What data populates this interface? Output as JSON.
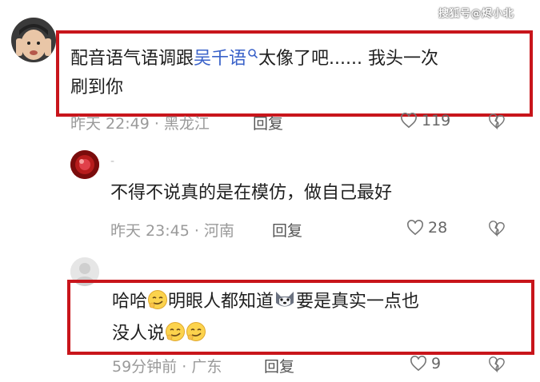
{
  "watermark": "搜狐号@烬小北",
  "comments": [
    {
      "username": "",
      "text_before": "配音语气语调跟",
      "link_text": "吴千语",
      "text_after": "太像了吧...... 我头一次",
      "text_line2": "刷到你",
      "time": "昨天 22:49",
      "location": "黑龙江",
      "reply_label": "回复",
      "likes": "119",
      "highlighted": true
    },
    {
      "username": "-",
      "text": "不得不说真的是在模仿，做自己最好",
      "time": "昨天 23:45",
      "location": "河南",
      "reply_label": "回复",
      "likes": "28",
      "highlighted": false
    },
    {
      "username": "",
      "text_part1": "哈哈",
      "text_part2": "明眼人都知道",
      "text_part3": "要是真实一点也",
      "text_line2": "没人说",
      "time": "59分钟前",
      "location": "广东",
      "reply_label": "回复",
      "likes": "9",
      "highlighted": true
    }
  ],
  "colors": {
    "highlight_border": "#c8151b",
    "link": "#3a62c9",
    "meta": "#9a9a9a"
  },
  "icons": {
    "like": "heart-outline-icon",
    "dislike": "broken-heart-icon",
    "emoji_smirk": "smirk-emoji-icon",
    "emoji_dog": "husky-dog-emoji-icon",
    "search": "magnifier-icon"
  }
}
